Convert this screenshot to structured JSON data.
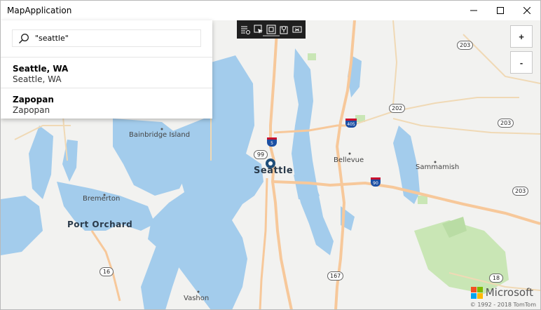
{
  "window": {
    "title": "MapApplication"
  },
  "search": {
    "value": "\"seattle\"",
    "placeholder": "",
    "results": [
      {
        "name": "Seattle, WA",
        "detail": "Seattle, WA"
      },
      {
        "name": "Zapopan",
        "detail": "Zapopan"
      }
    ]
  },
  "zoom": {
    "in_label": "+",
    "out_label": "-"
  },
  "map": {
    "labels": {
      "bainbridge": "Bainbridge Island",
      "seattle": "Seattle",
      "bellevue": "Bellevue",
      "sammamish": "Sammamish",
      "bremerton": "Bremerton",
      "port_orchard": "Port Orchard",
      "vashon": "Vashon"
    },
    "shields": {
      "r203_top": "203",
      "r202": "202",
      "r203_right": "203",
      "r203_mid": "203",
      "r99": "99",
      "i5": "5",
      "i405": "405",
      "i90": "90",
      "r16": "16",
      "r167": "167",
      "r18": "18"
    },
    "brand": "Microsoft",
    "copyright": "© 1992 - 2018 TomTom"
  },
  "icons": {
    "search": "search-icon",
    "minimize": "minimize-icon",
    "maximize": "maximize-icon",
    "close": "close-icon",
    "tools": [
      "layer-list-icon",
      "select-icon",
      "square-icon",
      "map-pin-icon",
      "screenshot-icon"
    ]
  },
  "colors": {
    "water": "#a3ccec",
    "land": "#f2f2f0",
    "park": "#c9e6b5",
    "highway": "#f7c89a",
    "accent": "#1f4e79"
  }
}
